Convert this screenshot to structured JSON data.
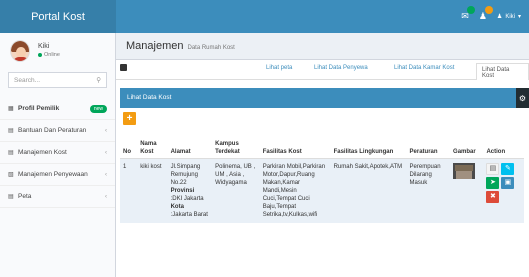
{
  "header": {
    "brand": "Portal Kost",
    "user_name": "Kiki",
    "notifications": [
      {
        "icon": "envelope-icon",
        "count": "",
        "color": "#00a65a"
      },
      {
        "icon": "user-alert-icon",
        "count": "",
        "color": "#f39c12"
      }
    ]
  },
  "sidebar": {
    "user": {
      "name": "Kiki",
      "status": "Online"
    },
    "search_placeholder": "Search...",
    "items": [
      {
        "label": "Profil Pemilik",
        "badge": "new",
        "icon": "grid-icon"
      },
      {
        "label": "Bantuan Dan Peraturan",
        "icon": "list-icon"
      },
      {
        "label": "Manajemen Kost",
        "icon": "list-icon"
      },
      {
        "label": "Manajemen Penyewaan",
        "icon": "chart-icon"
      },
      {
        "label": "Peta",
        "icon": "list-icon"
      }
    ]
  },
  "page": {
    "title": "Manajemen",
    "subtitle": "Data Rumah Kost"
  },
  "tabs": [
    {
      "label": "Lihat peta"
    },
    {
      "label": "Lihat Data Penyewa"
    },
    {
      "label": "Lihat Data Kamar Kost"
    },
    {
      "label": "Lihat Data Kost"
    }
  ],
  "panel": {
    "title": "Lihat Data Kost",
    "add_label": "+"
  },
  "table": {
    "headers": [
      "No",
      "Nama Kost",
      "Alamat",
      "Kampus Terdekat",
      "Fasilitas Kost",
      "Fasilitas Lingkungan",
      "Peraturan",
      "Gambar",
      "Action"
    ],
    "rows": [
      {
        "no": "1",
        "nama": "kiki kost",
        "alamat": "Jl.Simpang Remujung No.22",
        "provinsi_label": "Provinsi",
        "provinsi": ":DKI Jakarta",
        "kota_label": "Kota",
        "kota": ":Jakarta Barat",
        "kampus": "Polinema, UB , UM , Asia , Widyagama",
        "fasilitas_kost": "Parkiran Mobil,Parkiran Motor,Dapur,Ruang Makan,Kamar Mandi,Mesin Cuci,Tempat Cuci Baju,Tempat Setrika,tv,Kulkas,wifi",
        "fasilitas_lingkungan": "Rumah Sakit,Apotek,ATM",
        "peraturan": "Perempuan Dilarang Masuk"
      }
    ]
  }
}
